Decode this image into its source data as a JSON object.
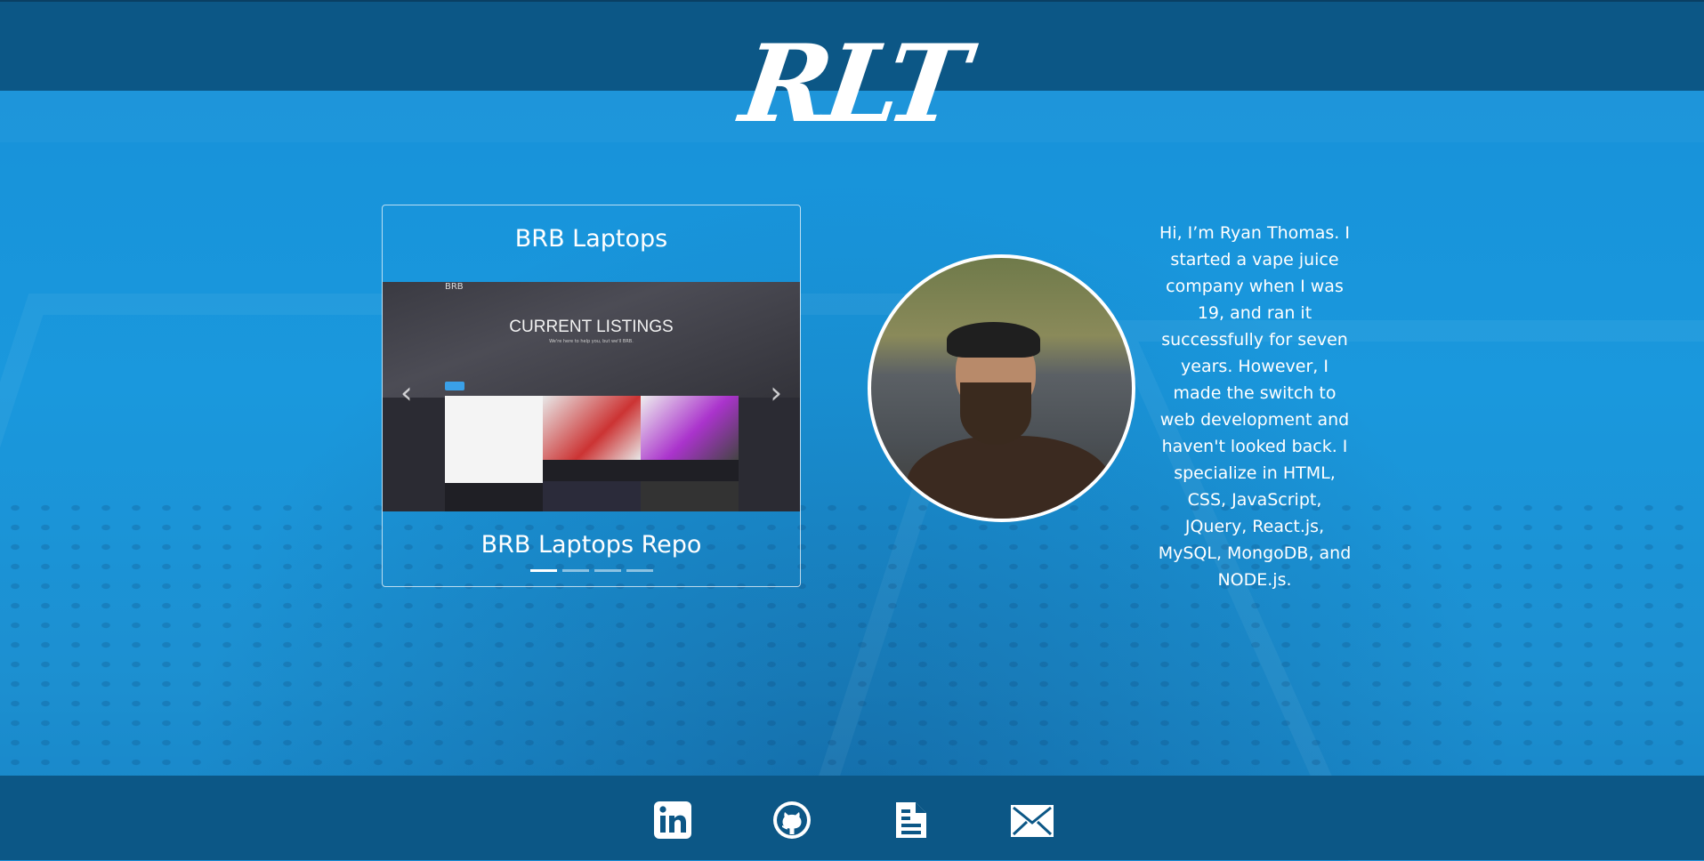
{
  "header": {
    "logo": "RLT",
    "background_color": "#0c5786"
  },
  "project_carousel": {
    "title": "BRB Laptops",
    "slide": {
      "brand": "BRB",
      "heading": "CURRENT LISTINGS",
      "subheading": "We're here to help you, but we'll BRB."
    },
    "caption": "BRB Laptops Repo",
    "prev_label": "‹",
    "next_label": "›",
    "slide_count": 4,
    "active_index": 0
  },
  "profile": {
    "photo_icon": "avatar-photo",
    "bio": "Hi, I’m Ryan Thomas. I started a vape juice company when I was 19, and ran it successfully for seven years. However, I made the switch to web development and haven't looked back. I specialize in HTML, CSS, JavaScript, JQuery, React.js, MySQL, MongoDB, and NODE.js."
  },
  "footer": {
    "links": [
      {
        "icon": "linkedin-icon"
      },
      {
        "icon": "github-icon"
      },
      {
        "icon": "resume-icon"
      },
      {
        "icon": "email-icon"
      }
    ],
    "background_color": "#0c5786"
  },
  "colors": {
    "page_background": "#1a8fd6",
    "text": "#ffffff"
  }
}
